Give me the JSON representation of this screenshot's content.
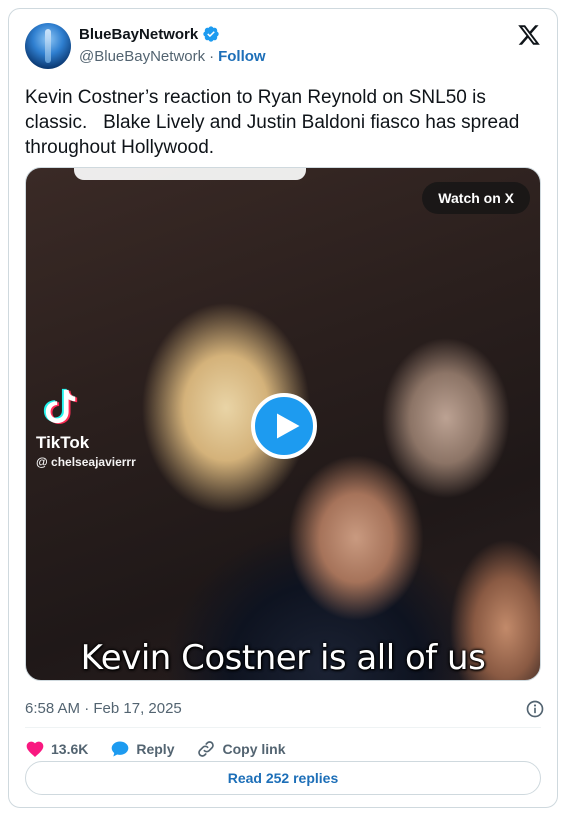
{
  "author": {
    "display_name": "BlueBayNetwork",
    "handle": "@BlueBayNetwork",
    "separator": "·",
    "follow_label": "Follow"
  },
  "tweet": {
    "text": "Kevin Costner’s reaction to Ryan Reynold on SNL50 is classic.   Blake Lively and Justin Baldoni fiasco has spread throughout Hollywood.",
    "timestamp": "6:58 AM · Feb 17, 2025"
  },
  "media": {
    "watch_label": "Watch on X",
    "tiktok_brand": "TikTok",
    "tiktok_user": "@ chelseajavierrr",
    "caption": "Kevin Costner is all of us"
  },
  "actions": {
    "likes": "13.6K",
    "reply_label": "Reply",
    "copy_link_label": "Copy link"
  },
  "read_replies_label": "Read 252 replies",
  "colors": {
    "link_blue": "#1d6fb8",
    "verified_blue": "#1d9bf0",
    "like_pink": "#f91880",
    "muted": "#536471"
  },
  "icons": [
    "verified-badge-icon",
    "x-logo-icon",
    "play-icon",
    "tiktok-logo-icon",
    "info-icon",
    "heart-icon",
    "reply-bubble-icon",
    "link-icon"
  ]
}
